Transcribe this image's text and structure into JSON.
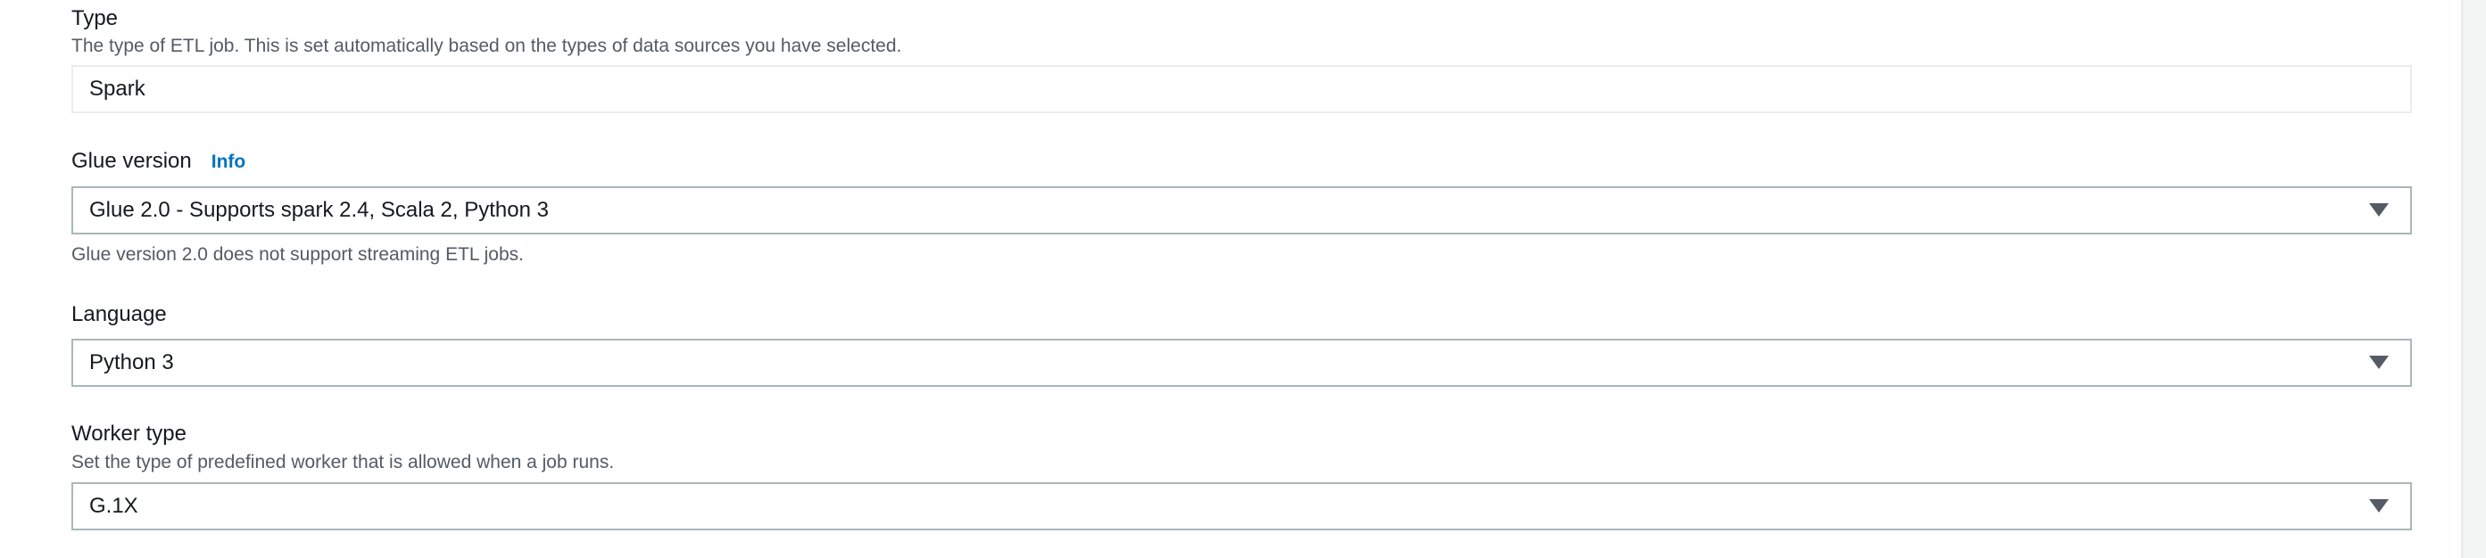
{
  "type_section": {
    "label": "Type",
    "description": "The type of ETL job. This is set automatically based on the types of data sources you have selected.",
    "value": "Spark"
  },
  "glue_version_section": {
    "label": "Glue version",
    "info_link": "Info",
    "selected": "Glue 2.0 - Supports spark 2.4, Scala 2, Python 3",
    "hint": "Glue version 2.0 does not support streaming ETL jobs."
  },
  "language_section": {
    "label": "Language",
    "selected": "Python 3"
  },
  "worker_type_section": {
    "label": "Worker type",
    "description": "Set the type of predefined worker that is allowed when a job runs.",
    "selected": "G.1X"
  },
  "icons": {
    "dropdown": "caret-down-icon"
  },
  "colors": {
    "link": "#0073bb",
    "select_border": "#aab7b8",
    "readonly_border": "#eaeded",
    "secondary_text": "#545b64"
  }
}
